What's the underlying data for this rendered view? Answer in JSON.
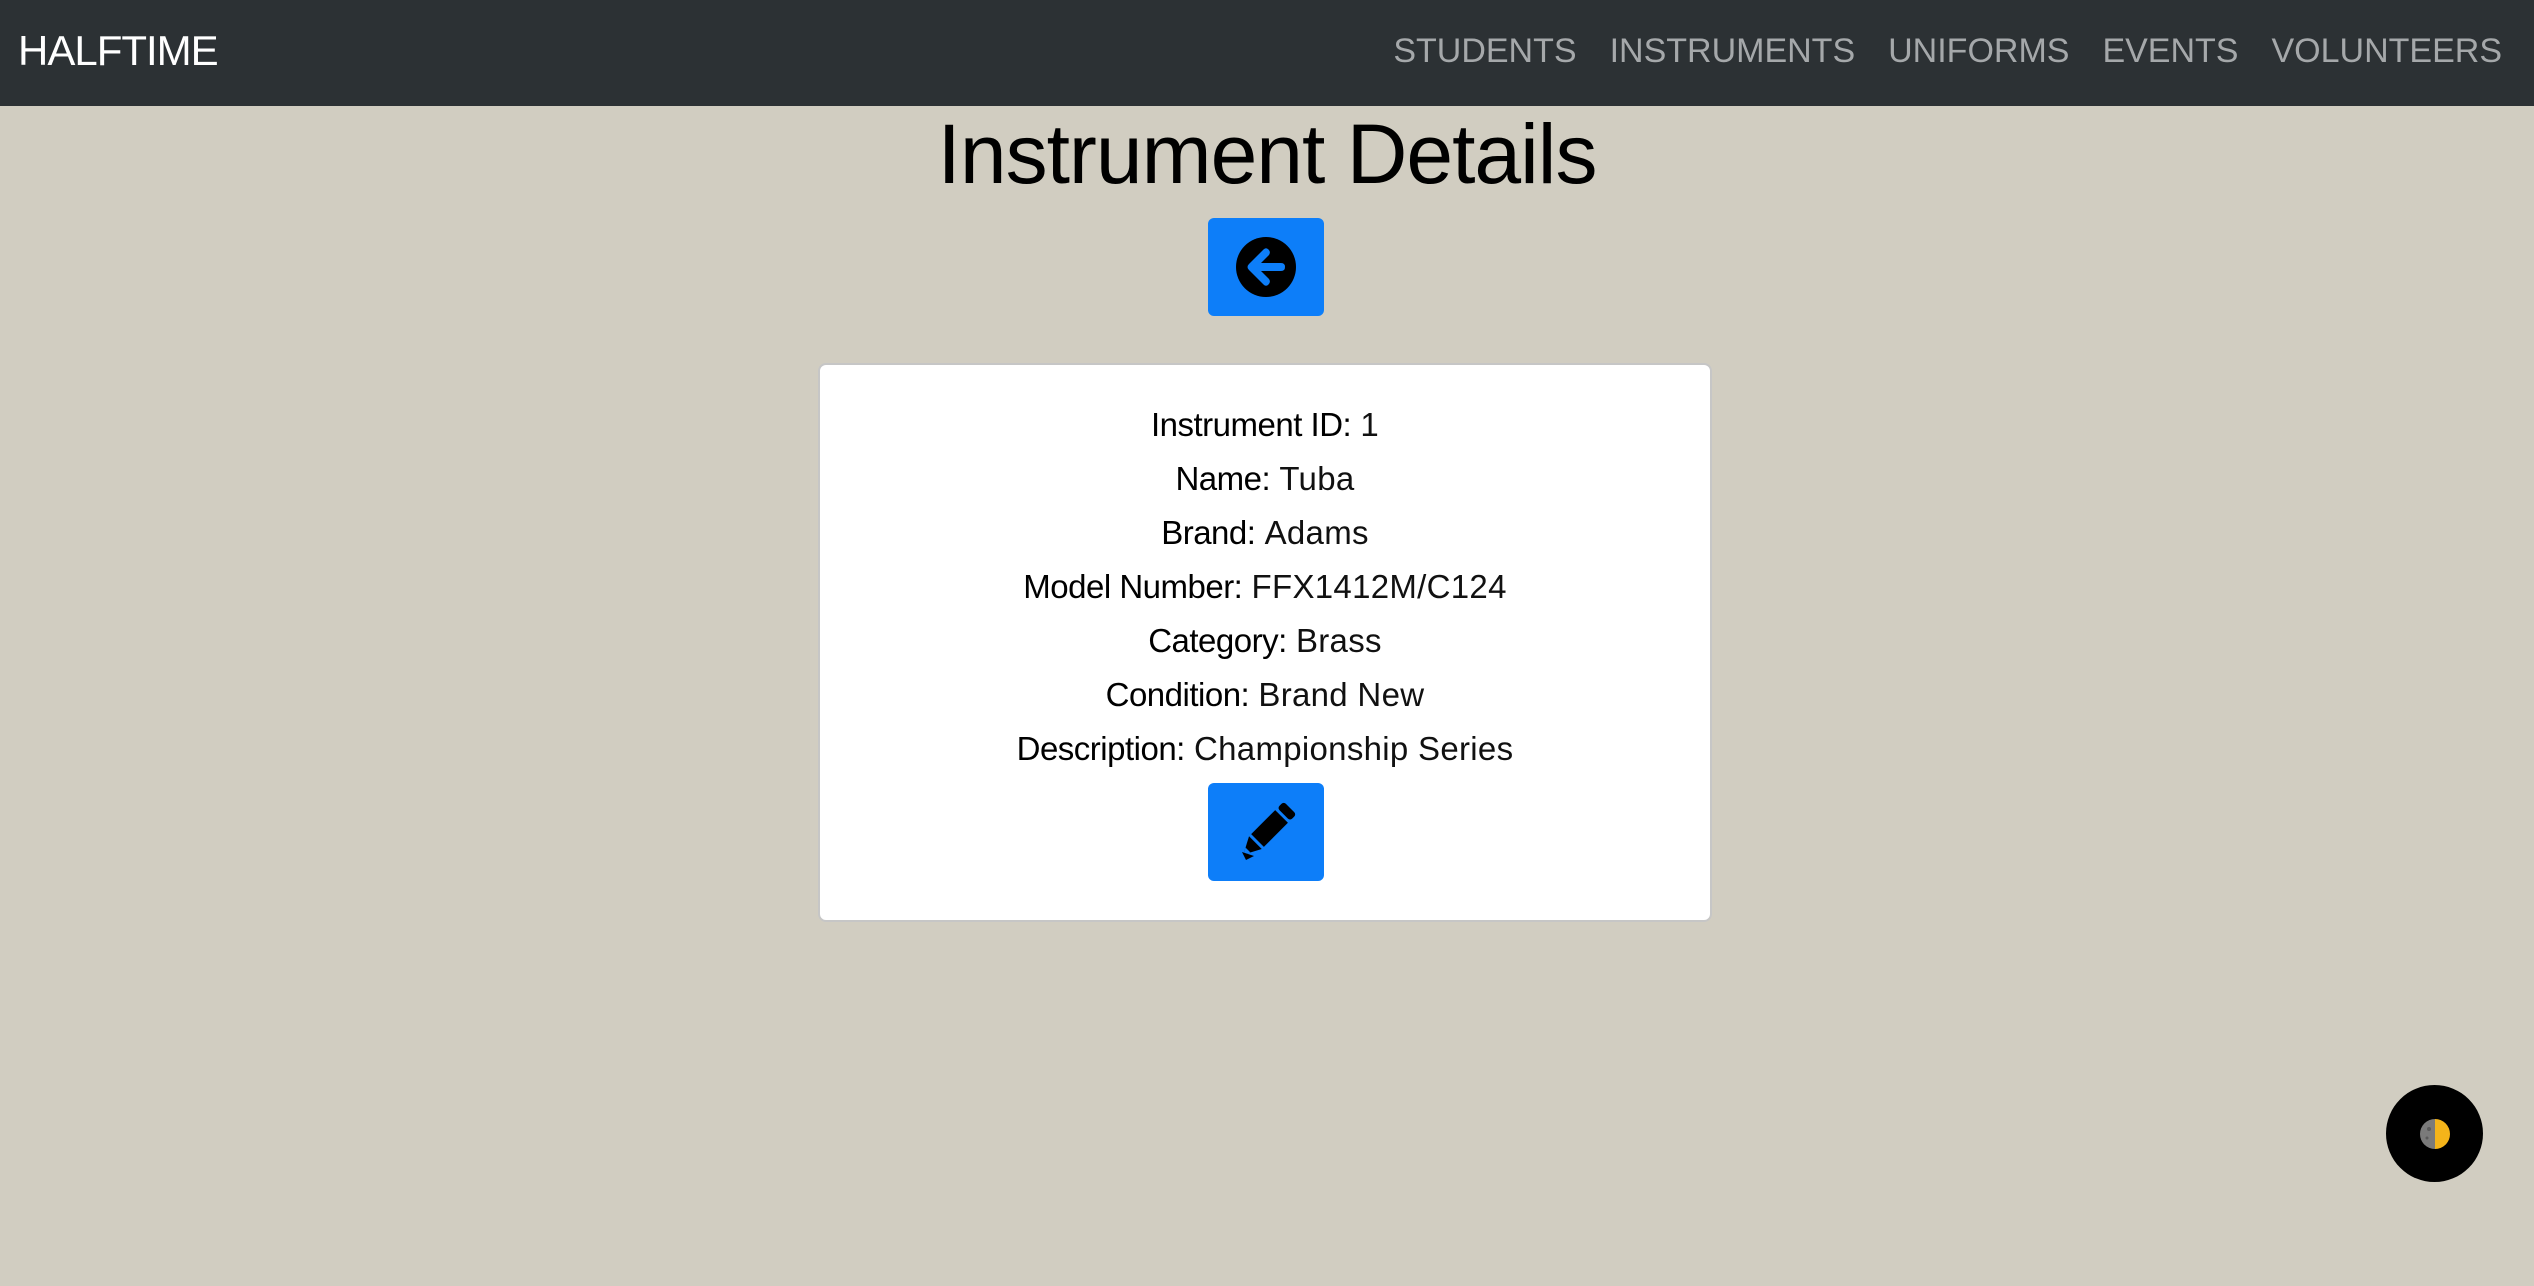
{
  "app": {
    "brand": "HALFTIME"
  },
  "nav": {
    "items": [
      {
        "label": "STUDENTS"
      },
      {
        "label": "INSTRUMENTS"
      },
      {
        "label": "UNIFORMS"
      },
      {
        "label": "EVENTS"
      },
      {
        "label": "VOLUNTEERS"
      }
    ]
  },
  "page": {
    "title": "Instrument Details",
    "back_button_icon": "arrow-circle-left-icon",
    "edit_button_icon": "pencil-icon"
  },
  "details": {
    "id": {
      "label": "Instrument ID:",
      "value": "1"
    },
    "name": {
      "label": "Name:",
      "value": "Tuba"
    },
    "brand": {
      "label": "Brand:",
      "value": "Adams"
    },
    "model_number": {
      "label": "Model Number:",
      "value": "FFX1412M/C124"
    },
    "category": {
      "label": "Category:",
      "value": "Brass"
    },
    "condition": {
      "label": "Condition:",
      "value": "Brand New"
    },
    "description": {
      "label": "Description:",
      "value": "Championship Series"
    }
  },
  "theme_toggle": {
    "icon": "half-moon-icon"
  },
  "colors": {
    "navbar_bg": "#2c3134",
    "page_bg": "#d1cdc1",
    "primary": "#0d7ef9",
    "nav_link": "#a5a8aa",
    "toggle_accent": "#f4b41a"
  }
}
